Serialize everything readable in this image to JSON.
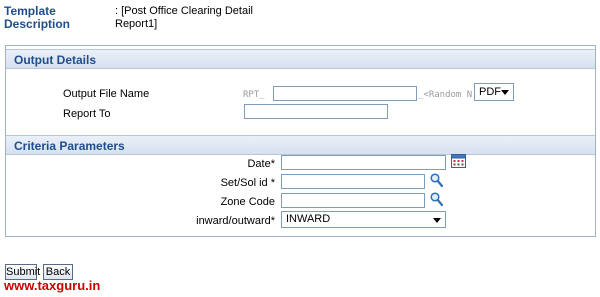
{
  "header": {
    "template_label": "Template",
    "template_value": ": [Post Office Clearing Detail",
    "description_label": "Description",
    "description_value": "Report1]"
  },
  "output_details": {
    "title": "Output Details",
    "output_file_label": "Output File Name",
    "prefix": "RPT_",
    "output_file_value": "",
    "suffix_hint": "_<Random N",
    "format_selected": "PDF",
    "report_to_label": "Report To",
    "report_to_value": ""
  },
  "criteria": {
    "title": "Criteria Parameters",
    "date_label": "Date*",
    "date_value": "",
    "set_sol_label": "Set/Sol id *",
    "set_sol_value": "",
    "zone_label": "Zone Code",
    "zone_value": "",
    "inout_label": "inward/outward*",
    "inout_selected": "INWARD"
  },
  "buttons": {
    "submit": "Submit",
    "back": "Back"
  },
  "watermark": "www.taxguru.in",
  "colors": {
    "section_title": "#1f4e8c",
    "watermark": "#cc0000"
  }
}
